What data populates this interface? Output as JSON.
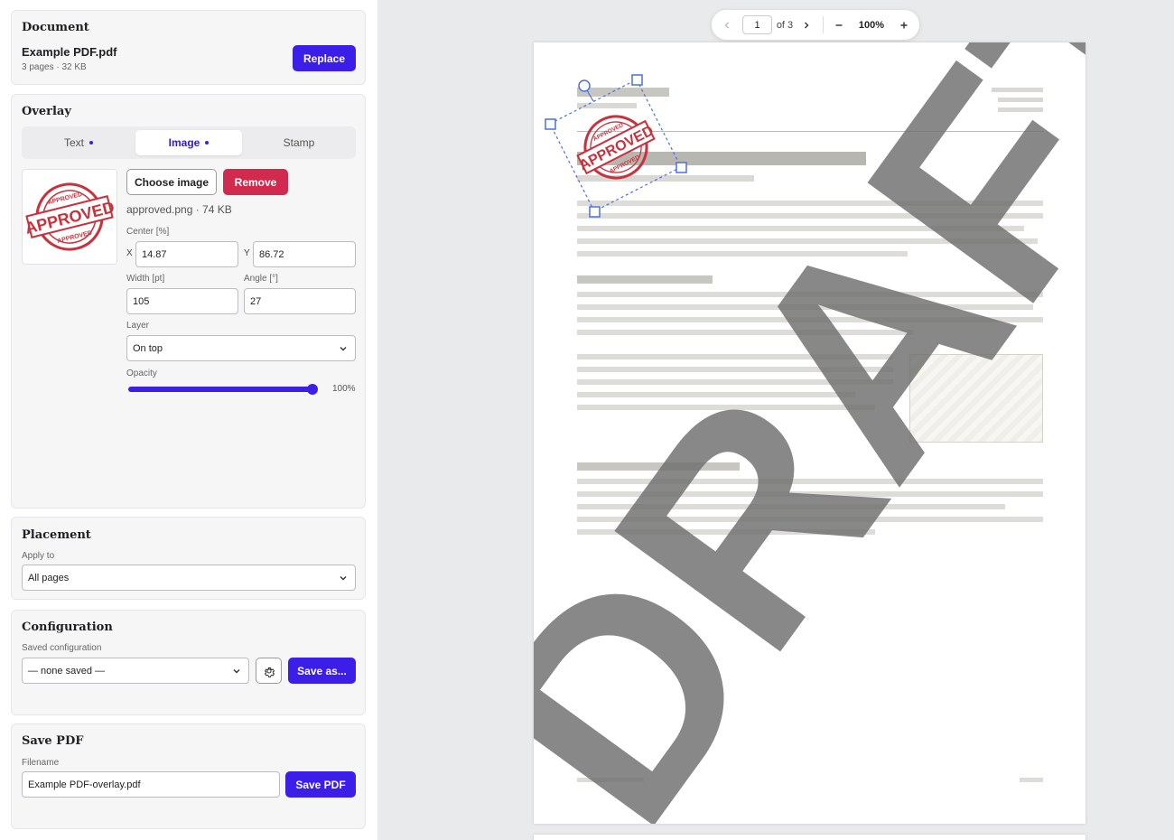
{
  "document": {
    "title": "Document",
    "filename": "Example PDF.pdf",
    "meta": "3 pages · 32 KB",
    "replace_label": "Replace"
  },
  "overlay": {
    "title": "Overlay",
    "tabs": [
      {
        "label": "Text",
        "dot": true,
        "active": false
      },
      {
        "label": "Image",
        "dot": true,
        "active": true
      },
      {
        "label": "Stamp",
        "dot": false,
        "active": false
      }
    ],
    "choose_label": "Choose image",
    "remove_label": "Remove",
    "image_info": "approved.png · 74 KB",
    "thumbnail": {
      "ring_text": "APPROVED",
      "main_text": "APPROVED"
    },
    "center_label": "Center [%]",
    "x_label": "X",
    "x_value": "14.87",
    "y_label": "Y",
    "y_value": "86.72",
    "width_label": "Width [pt]",
    "width_value": "105",
    "angle_label": "Angle [°]",
    "angle_value": "27",
    "layer_label": "Layer",
    "layer_value": "On top",
    "opacity_label": "Opacity",
    "opacity_value": "100%",
    "opacity_fraction": 1.0
  },
  "placement": {
    "title": "Placement",
    "apply_label": "Apply to",
    "apply_value": "All pages"
  },
  "configuration": {
    "title": "Configuration",
    "saved_label": "Saved configuration",
    "saved_value": "— none saved —",
    "settings_icon": "gear-icon",
    "save_as_label": "Save as..."
  },
  "save_pdf": {
    "title": "Save PDF",
    "filename_label": "Filename",
    "filename_value": "Example PDF-overlay.pdf",
    "save_label": "Save PDF"
  },
  "viewer": {
    "page_input": "1",
    "page_total": "of 3",
    "zoom": "100%",
    "watermark_text": "DRAFT",
    "stamp_text": "APPROVED"
  },
  "colors": {
    "accent": "#3b1ee8",
    "danger": "#d22a4f",
    "stamp_red": "#c8323c",
    "watermark": "#6e6e6e"
  }
}
